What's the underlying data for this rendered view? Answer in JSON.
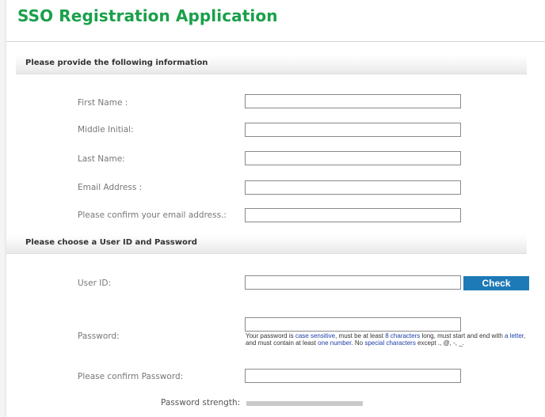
{
  "header": {
    "title": "SSO Registration Application"
  },
  "personal_section": {
    "heading": "Please provide the following information",
    "fields": [
      {
        "label": "First Name :",
        "value": "",
        "placeholder": ""
      },
      {
        "label": "Middle Initial:",
        "value": "",
        "placeholder": ""
      },
      {
        "label": "Last Name:",
        "value": "",
        "placeholder": ""
      },
      {
        "label": "Email Address :",
        "value": "",
        "placeholder": ""
      },
      {
        "label": "Please confirm your email address.:",
        "value": "",
        "placeholder": ""
      }
    ]
  },
  "account_section": {
    "heading": "Please choose a User ID and Password",
    "user_id": {
      "label": "User ID:",
      "value": ""
    },
    "check_label": "Check",
    "password": {
      "label": "Password:",
      "value": ""
    },
    "password_hint": {
      "t1": "Your password is ",
      "t2": "case sensitive",
      "t3": ", must be at least ",
      "t4": "8 characters",
      "t5": " long, must start and end with ",
      "t6": "a letter",
      "t7": ", and must contain at least ",
      "t8": "one number",
      "t9": ". No ",
      "t10": "special characters",
      "t11": " except ., @, -, _."
    },
    "confirm_password": {
      "label": "Please confirm Password:",
      "value": ""
    },
    "strength_label": "Password strength:",
    "strength_level": 0
  },
  "colors": {
    "title": "#1aa04a",
    "button": "#1e7ab6",
    "hint_link": "#1d3fa8"
  }
}
